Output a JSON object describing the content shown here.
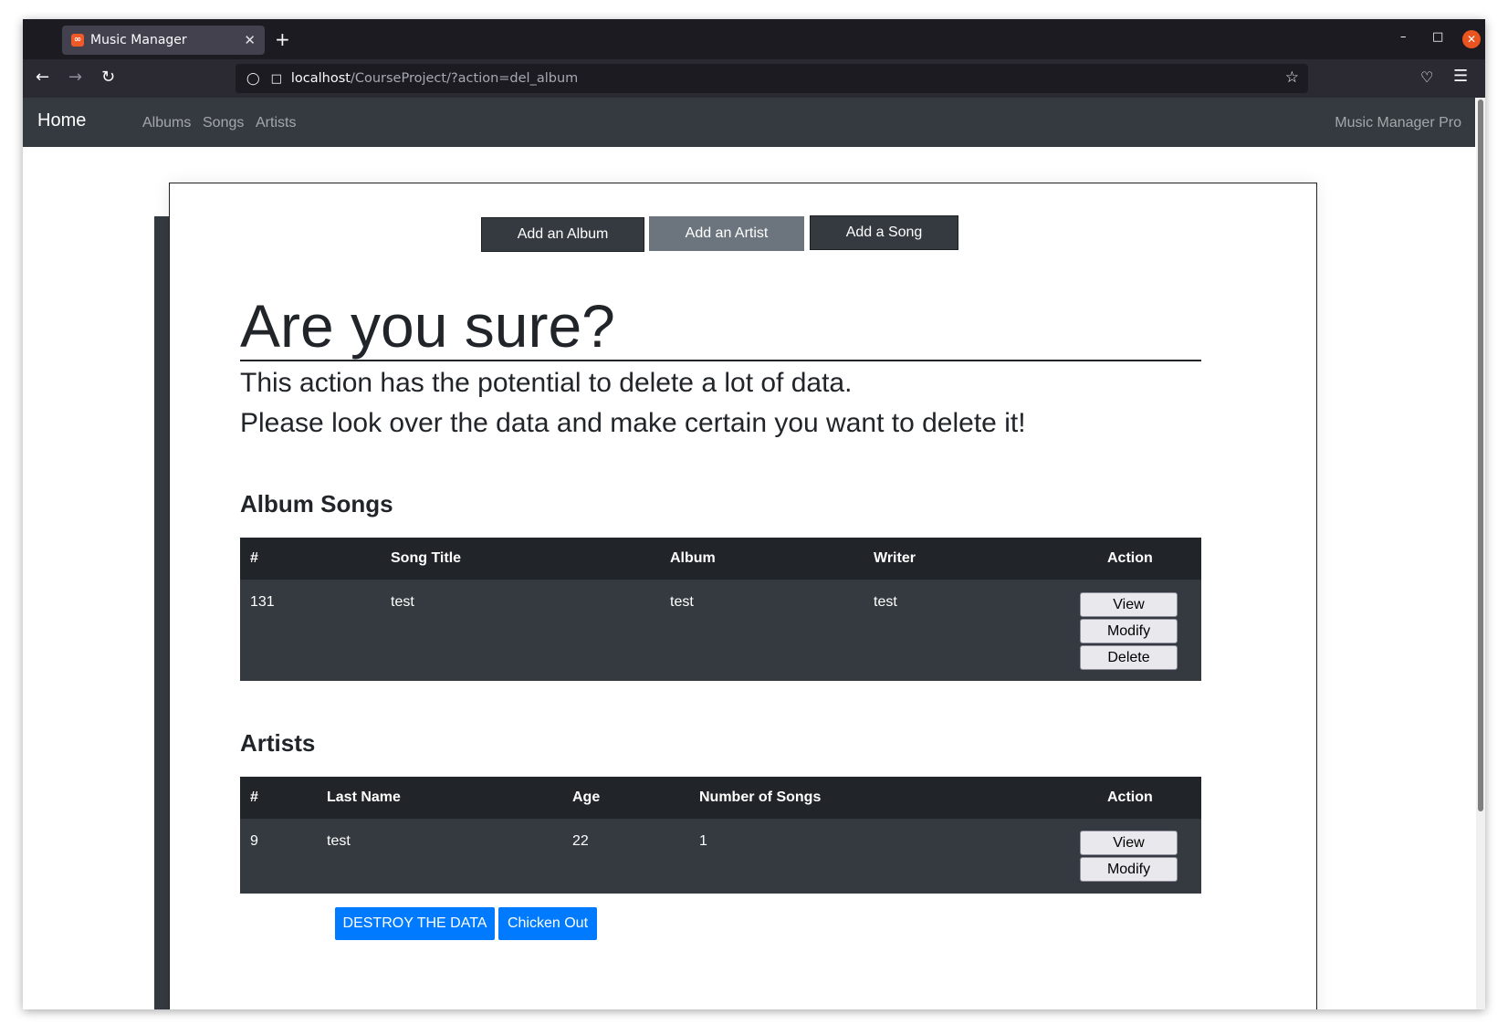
{
  "browser": {
    "tab_title": "Music Manager",
    "favicon": "xampp-favicon",
    "url_host": "localhost",
    "url_path": "/CourseProject/?action=del_album"
  },
  "navbar": {
    "brand": "Home",
    "links": [
      "Albums",
      "Songs",
      "Artists"
    ],
    "right_text": "Music Manager Pro"
  },
  "actions": {
    "add_album": "Add an Album",
    "add_artist": "Add an Artist",
    "add_song": "Add a Song"
  },
  "page": {
    "heading": "Are you sure?",
    "lead_1": "This action has the potential to delete a lot of data.",
    "lead_2": "Please look over the data and make certain you want to delete it!"
  },
  "album_songs": {
    "title": "Album Songs",
    "headers": [
      "#",
      "Song Title",
      "Album",
      "Writer",
      "Action"
    ],
    "rows": [
      {
        "id": "131",
        "title": "test",
        "album": "test",
        "writer": "test"
      }
    ],
    "row_buttons": [
      "View",
      "Modify",
      "Delete"
    ]
  },
  "artists": {
    "title": "Artists",
    "headers": [
      "#",
      "Last Name",
      "Age",
      "Number of Songs",
      "Action"
    ],
    "rows": [
      {
        "id": "9",
        "last_name": "test",
        "age": "22",
        "songs": "1"
      }
    ],
    "row_buttons": [
      "View",
      "Modify"
    ]
  },
  "confirm": {
    "destroy": "DESTROY THE DATA",
    "cancel": "Chicken Out"
  },
  "colors": {
    "navbar": "#343a40",
    "table_head": "#212529",
    "primary": "#007bff",
    "secondary": "#6c757d"
  }
}
